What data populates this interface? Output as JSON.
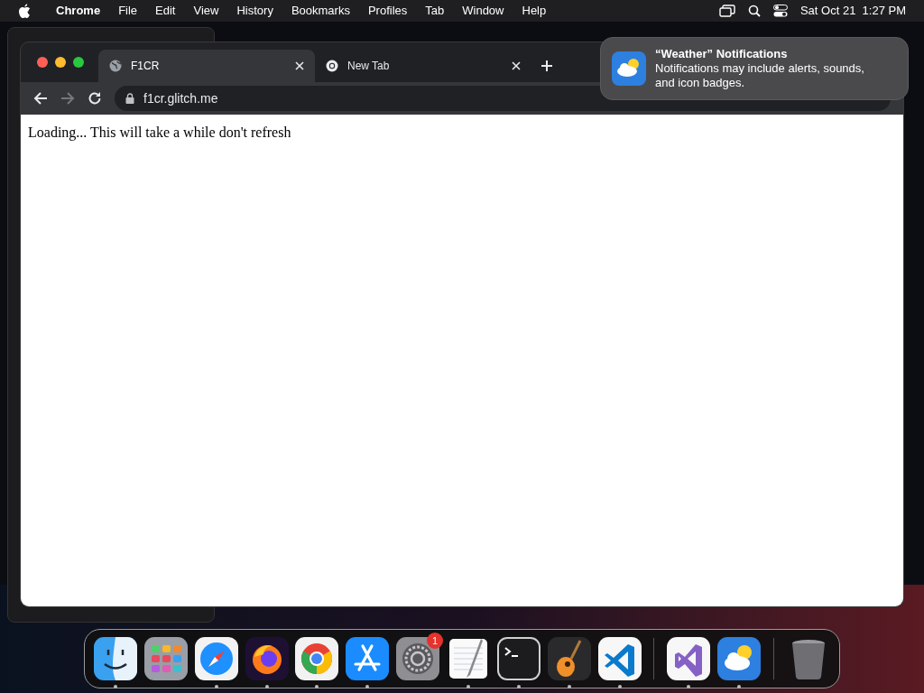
{
  "menu_bar": {
    "app": "Chrome",
    "menus": [
      "File",
      "Edit",
      "View",
      "History",
      "Bookmarks",
      "Profiles",
      "Tab",
      "Window",
      "Help"
    ],
    "datetime": "Sat Oct 21  1:27 PM"
  },
  "browser": {
    "tabs": [
      {
        "title": "F1CR",
        "selected": true,
        "kind": "globe"
      },
      {
        "title": "New Tab",
        "selected": false,
        "kind": "chrome"
      }
    ],
    "forward_disabled": true,
    "url": "f1cr.glitch.me",
    "page_text": "Loading... This will take a while don't refresh"
  },
  "notification": {
    "title": "“Weather” Notifications",
    "body": "Notifications may include alerts, sounds, and icon badges."
  },
  "dock": {
    "sections": [
      [
        {
          "kind": "finder",
          "running": true
        },
        {
          "kind": "launchpad",
          "running": false
        },
        {
          "kind": "safari",
          "running": true
        },
        {
          "kind": "firefox",
          "running": true
        },
        {
          "kind": "chrome",
          "running": true
        },
        {
          "kind": "appstore",
          "running": true
        },
        {
          "kind": "settings",
          "running": false,
          "badge": "1"
        },
        {
          "kind": "textedit",
          "running": true
        },
        {
          "kind": "terminal",
          "running": true
        },
        {
          "kind": "guitar",
          "running": true
        },
        {
          "kind": "vscode",
          "running": true
        }
      ],
      [
        {
          "kind": "visualstudio",
          "running": true
        },
        {
          "kind": "weather",
          "running": true
        }
      ],
      [
        {
          "kind": "trash",
          "running": false
        }
      ]
    ]
  }
}
